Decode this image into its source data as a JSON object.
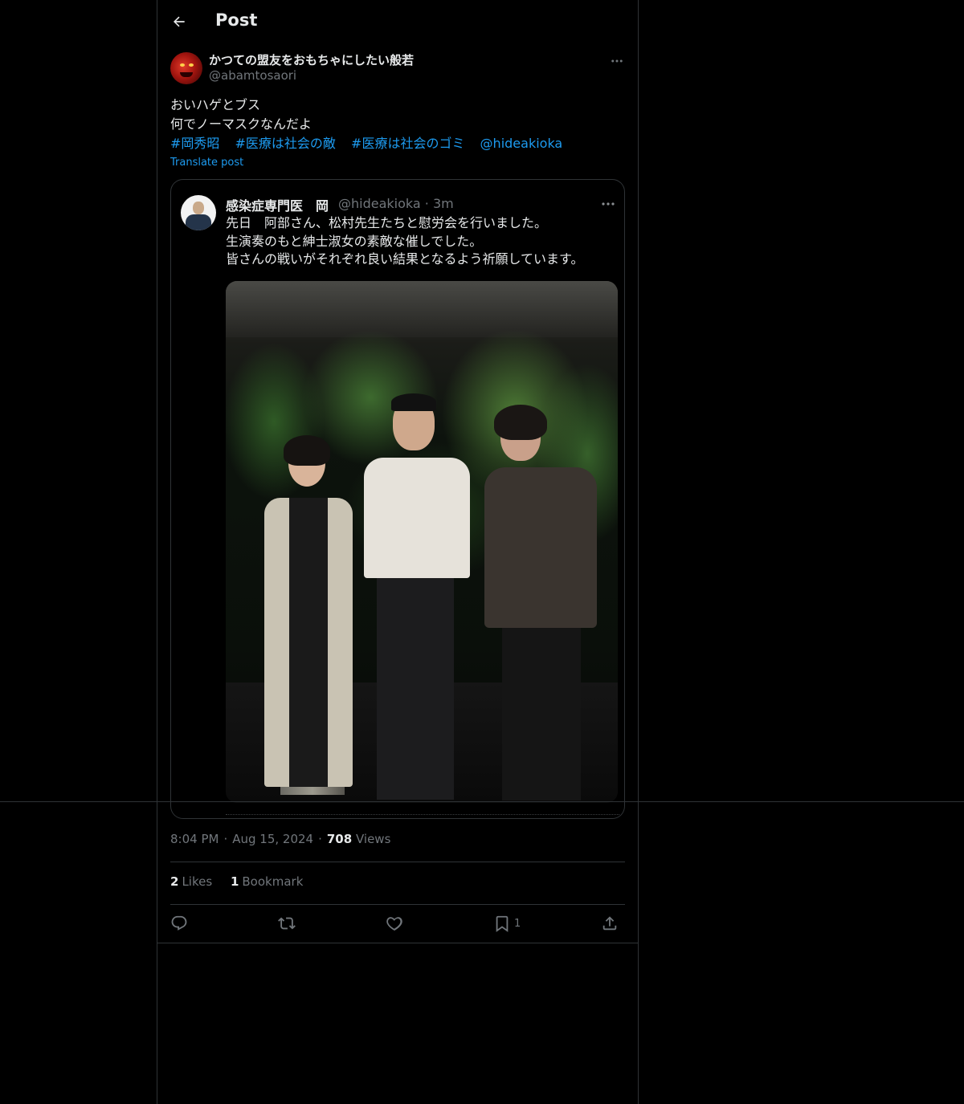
{
  "header": {
    "title": "Post",
    "back_icon": "arrow-left-icon"
  },
  "post": {
    "author": {
      "display_name": "かつての盟友をおもちゃにしたい般若",
      "handle": "@abamtosaori"
    },
    "text_lines": [
      "おいハゲとブス",
      "何でノーマスクなんだよ"
    ],
    "tags": [
      "#岡秀昭",
      "#医療は社会の敵",
      "#医療は社会のゴミ",
      "@hideakioka"
    ],
    "translate_label": "Translate post",
    "quoted": {
      "name": "感染症専門医　岡",
      "handle_time": "@hideakioka · 3m",
      "text_lines": [
        "先日　阿部さん、松村先生たちと慰労会を行いました。",
        "生演奏のもと紳士淑女の素敵な催しでした。",
        "皆さんの戦いがそれぞれ良い結果となるよう祈願しています。"
      ]
    },
    "time": "8:04 PM",
    "date": "Aug 15, 2024",
    "views_count": "708",
    "views_label": "Views",
    "likes_count": "2",
    "likes_label": "Likes",
    "bookmarks_count": "1",
    "bookmarks_label": "Bookmark",
    "actions": {
      "reply_icon": "reply-icon",
      "repost_icon": "repost-icon",
      "like_icon": "heart-icon",
      "bookmark_icon": "bookmark-icon",
      "bookmark_count": "1",
      "share_icon": "share-icon"
    }
  },
  "colors": {
    "background": "#000000",
    "text": "#e7e9ea",
    "secondary": "#71767b",
    "accent": "#1d9bf0",
    "border": "#2f3336"
  }
}
